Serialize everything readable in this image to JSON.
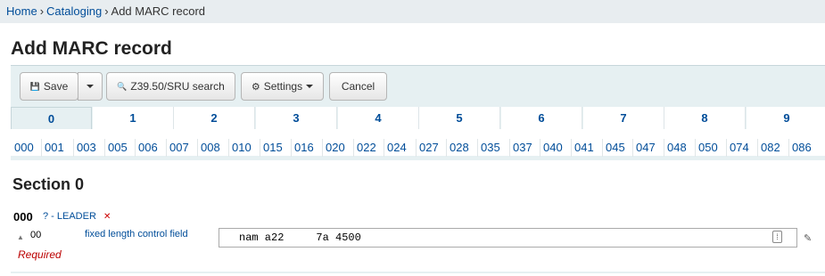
{
  "breadcrumbs": {
    "home": "Home",
    "sep": "›",
    "cataloging": "Cataloging",
    "current": "Add MARC record"
  },
  "page": {
    "title": "Add MARC record"
  },
  "toolbar": {
    "save_label": "Save",
    "save_icon": "💾",
    "search_label": "Z39.50/SRU search",
    "search_icon": "🔍",
    "settings_label": "Settings",
    "settings_icon": "⚙",
    "cancel_label": "Cancel"
  },
  "tabs": [
    "0",
    "1",
    "2",
    "3",
    "4",
    "5",
    "6",
    "7",
    "8",
    "9"
  ],
  "field_nav": [
    "000",
    "001",
    "003",
    "005",
    "006",
    "007",
    "008",
    "010",
    "015",
    "016",
    "020",
    "022",
    "024",
    "027",
    "028",
    "035",
    "037",
    "040",
    "041",
    "045",
    "047",
    "048",
    "050",
    "074",
    "082",
    "086"
  ],
  "section": {
    "title": "Section 0"
  },
  "tag": {
    "number": "000",
    "help": "? - LEADER",
    "delete_icon": "delete-field-icon",
    "subfield_code": "00",
    "subfield_label": "fixed length control field",
    "value": "nam a22     7a 4500",
    "required": "Required"
  },
  "colors": {
    "accent": "#004d99",
    "toolbar_bg": "#e6f0f2",
    "required": "#bb0000"
  }
}
